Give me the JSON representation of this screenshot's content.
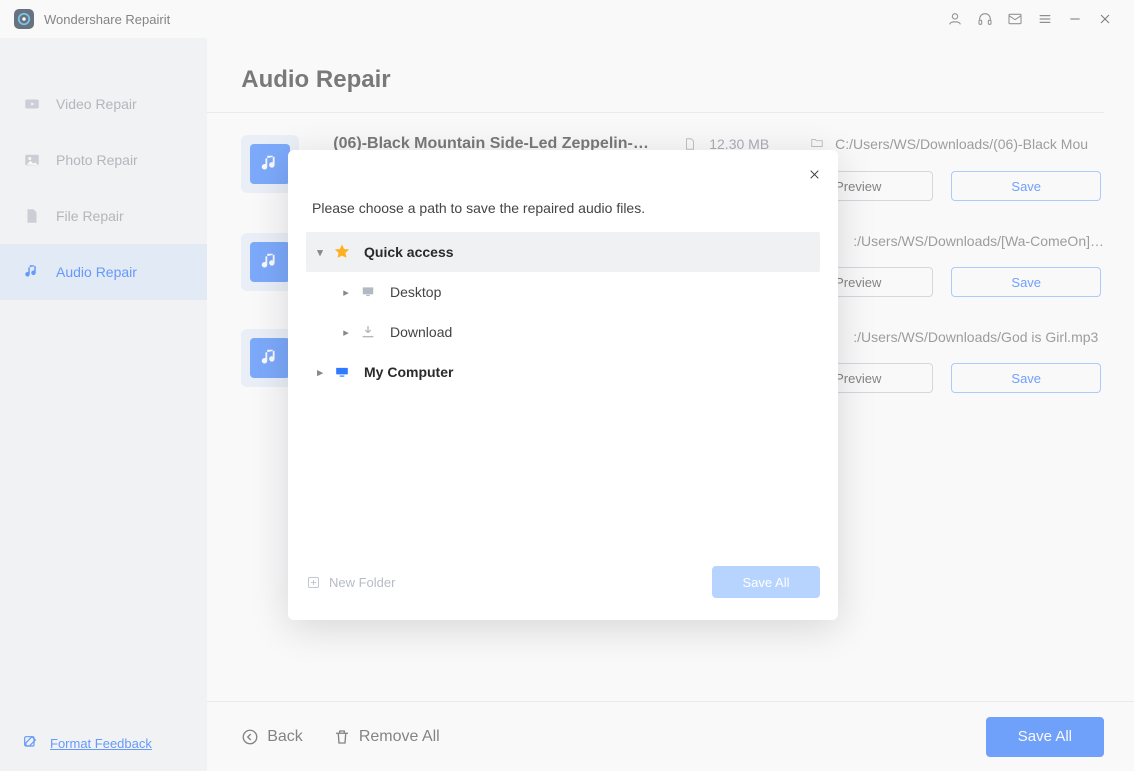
{
  "app": {
    "title": "Wondershare Repairit"
  },
  "sidebar": {
    "items": [
      {
        "label": "Video Repair"
      },
      {
        "label": "Photo Repair"
      },
      {
        "label": "File Repair"
      },
      {
        "label": "Audio Repair"
      }
    ],
    "footer_label": "Format Feedback"
  },
  "page": {
    "title": "Audio Repair"
  },
  "files": [
    {
      "name": "(06)-Black Mountain Side-Led Zeppelin-19…",
      "size": "12.30  MB",
      "path": "C:/Users/WS/Downloads/(06)-Black Mou…",
      "preview": "Preview",
      "save": "Save"
    },
    {
      "name": "",
      "size": "",
      "path": ":/Users/WS/Downloads/[Wa-ComeOn]…",
      "preview": "Preview",
      "save": "Save"
    },
    {
      "name": "",
      "size": "",
      "path": ":/Users/WS/Downloads/God is Girl.mp3",
      "preview": "Preview",
      "save": "Save"
    }
  ],
  "bottombar": {
    "back": "Back",
    "remove_all": "Remove All",
    "save_all": "Save All"
  },
  "dialog": {
    "instruction": "Please choose a path to save the repaired audio files.",
    "tree": {
      "quick_access": "Quick access",
      "desktop": "Desktop",
      "download": "Download",
      "my_computer": "My Computer"
    },
    "new_folder": "New Folder",
    "save_all": "Save All"
  }
}
